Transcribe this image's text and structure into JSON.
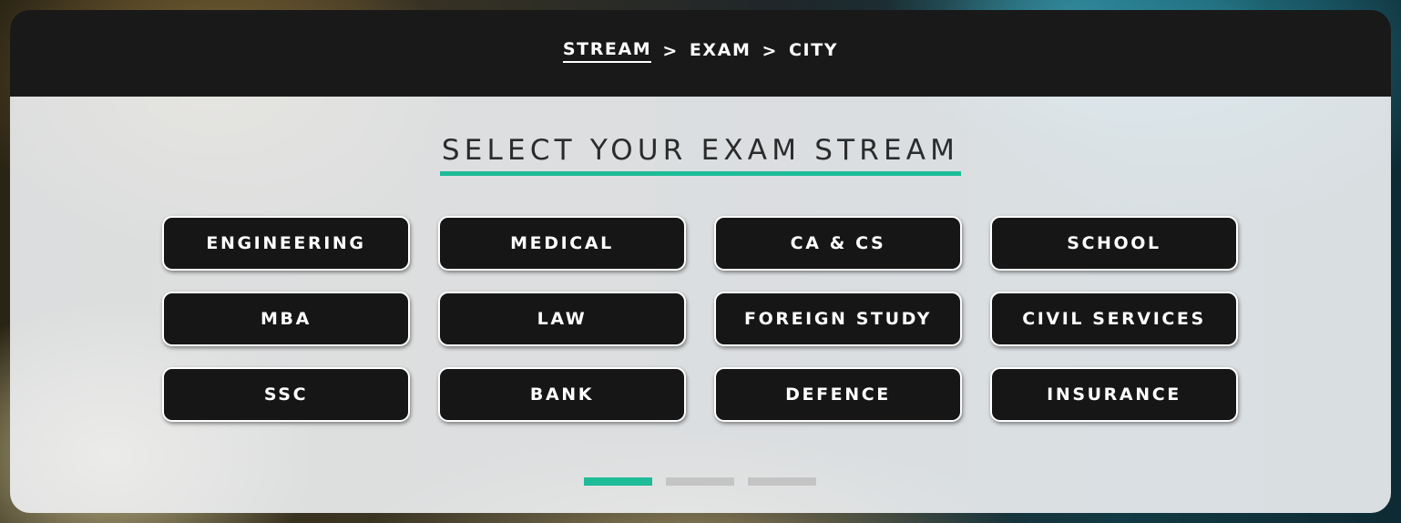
{
  "breadcrumb": {
    "items": [
      {
        "label": "STREAM",
        "active": true
      },
      {
        "label": "EXAM",
        "active": false
      },
      {
        "label": "CITY",
        "active": false
      }
    ],
    "separator": ">"
  },
  "main": {
    "heading": "SELECT YOUR EXAM STREAM",
    "streams": [
      "ENGINEERING",
      "MEDICAL",
      "CA & CS",
      "SCHOOL",
      "MBA",
      "LAW",
      "FOREIGN STUDY",
      "CIVIL SERVICES",
      "SSC",
      "BANK",
      "DEFENCE",
      "INSURANCE"
    ]
  },
  "pager": {
    "total_steps": 3,
    "active_step": 1
  },
  "colors": {
    "accent": "#1ebc98",
    "header_bg": "#191919",
    "button_bg": "#161616",
    "inactive_step": "#c4c4c4"
  }
}
